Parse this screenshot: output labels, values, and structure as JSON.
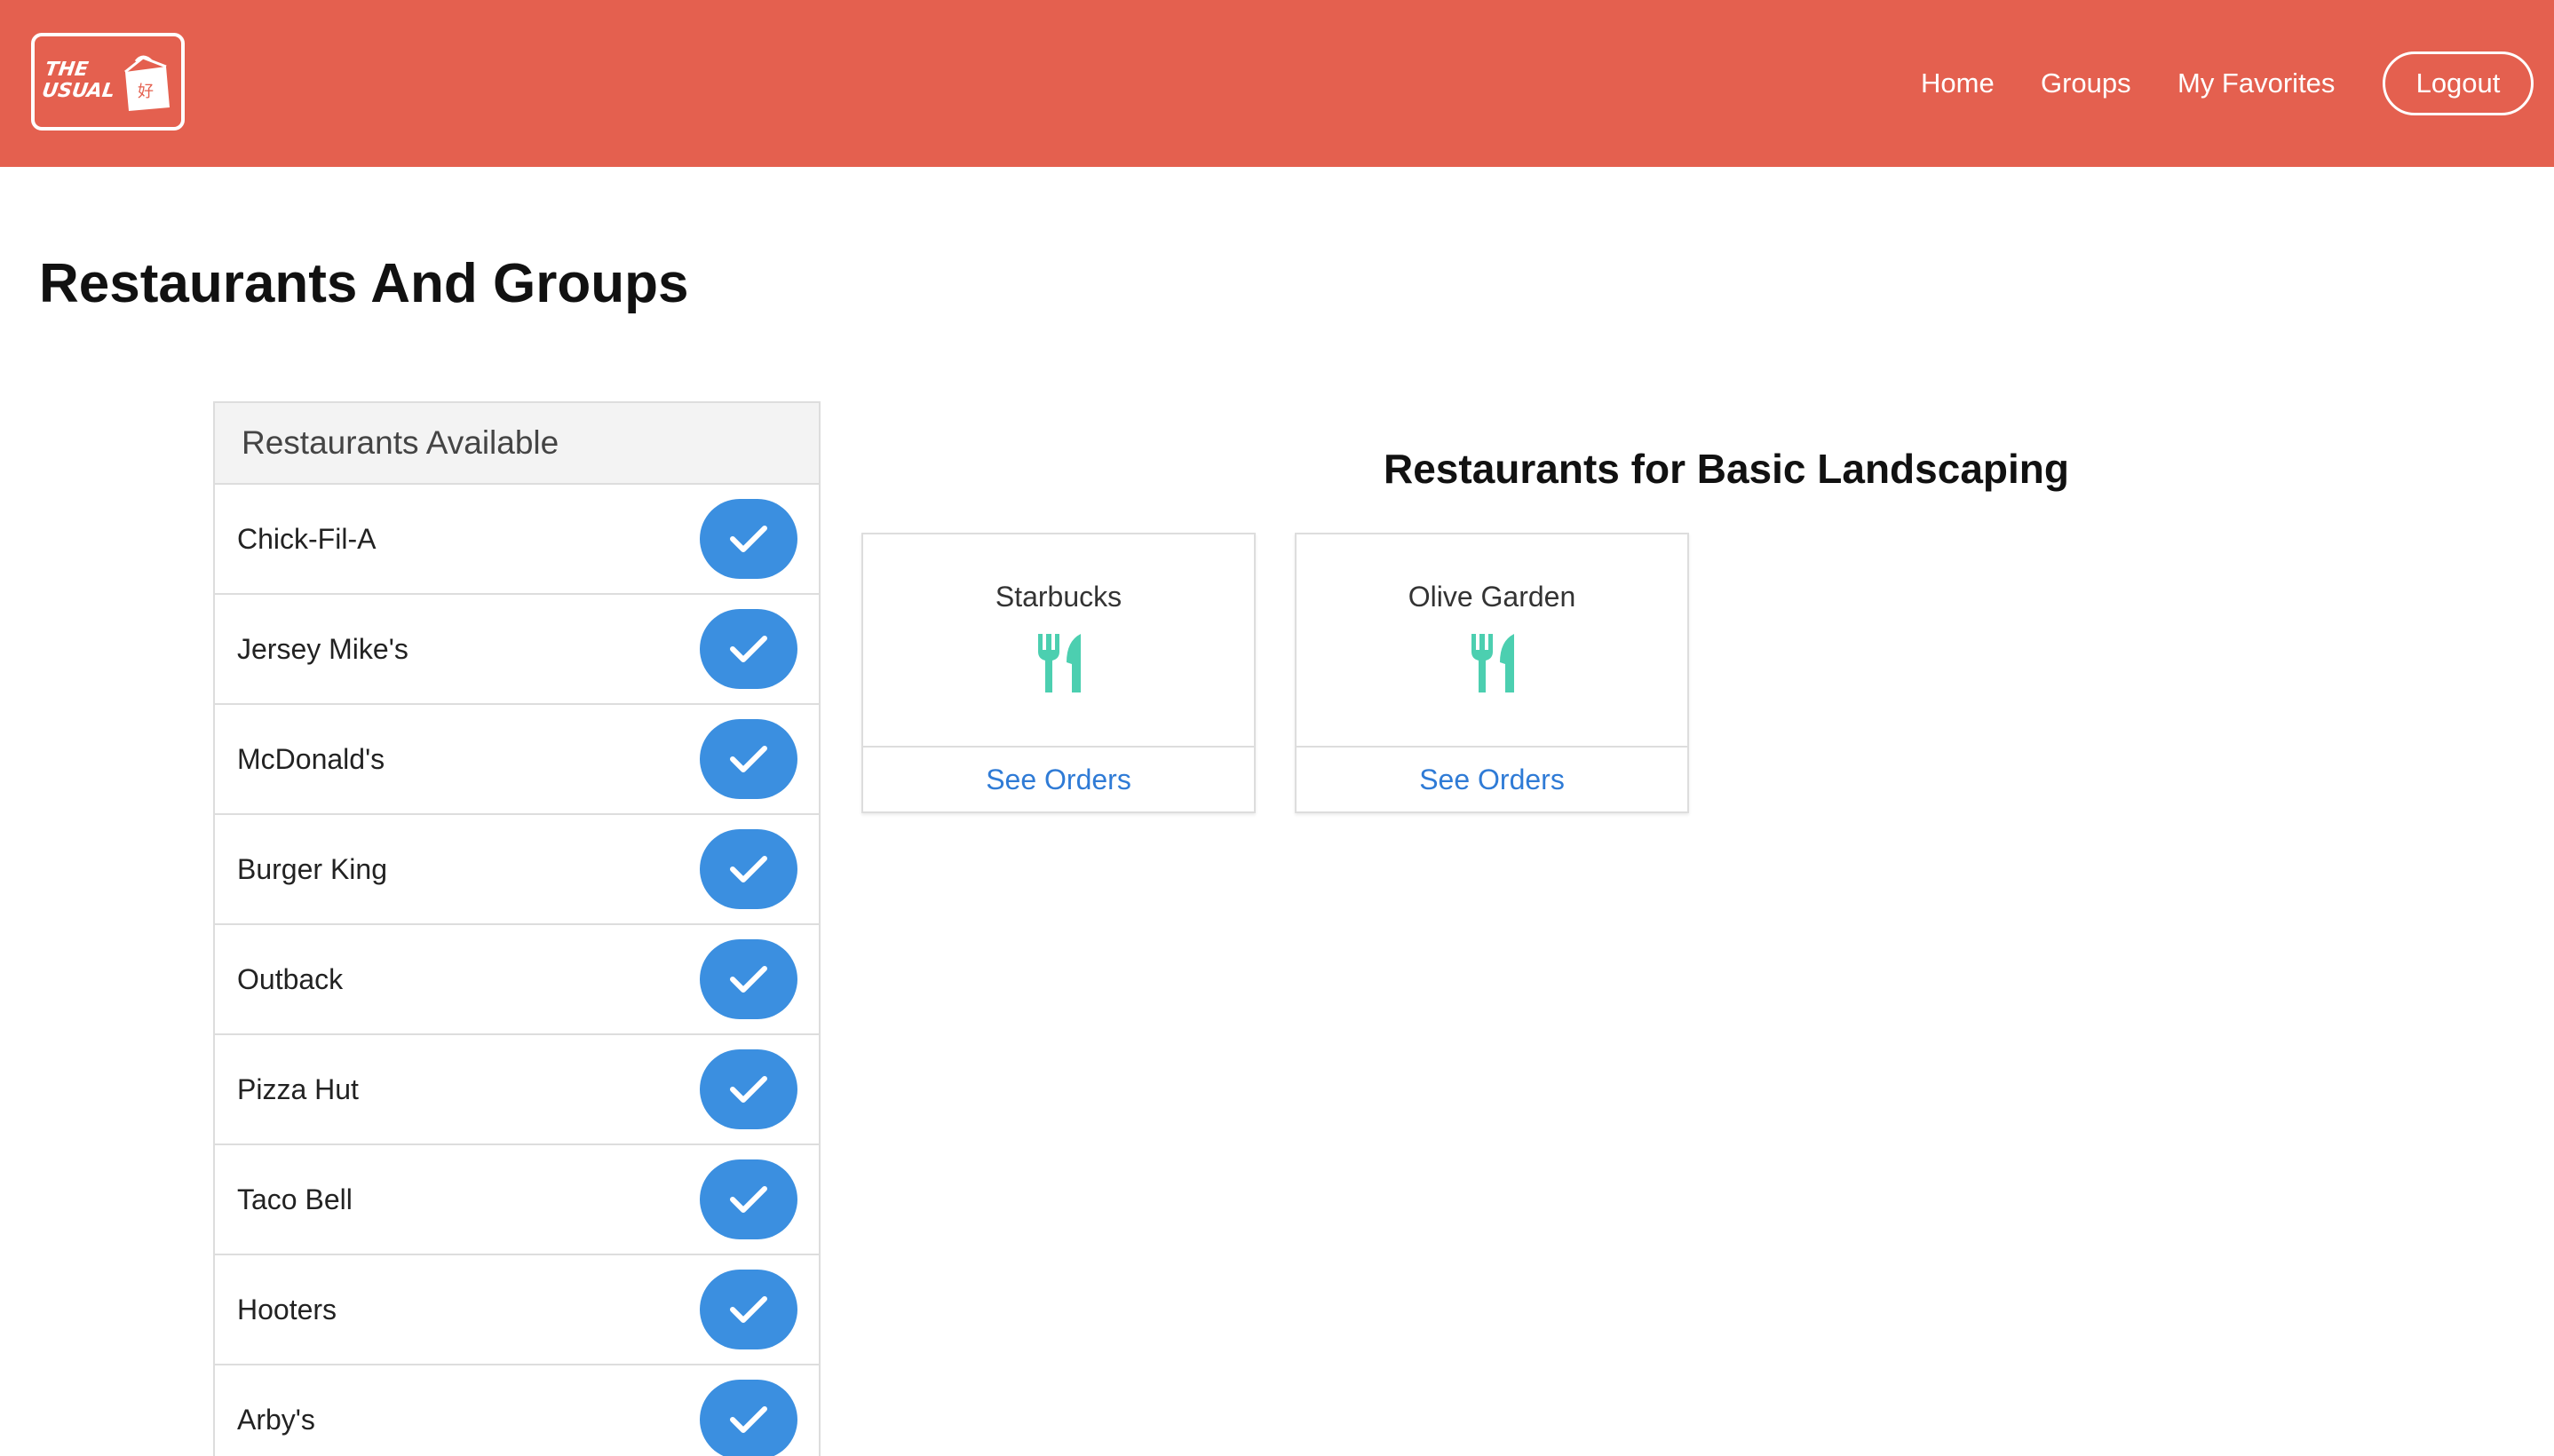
{
  "navbar": {
    "logo_text_line1": "THE",
    "logo_text_line2": "USUAL",
    "links": {
      "home": "Home",
      "groups": "Groups",
      "favorites": "My Favorites"
    },
    "logout_label": "Logout",
    "background_color": "#e4604f"
  },
  "page": {
    "title": "Restaurants And Groups"
  },
  "restaurants_list": {
    "header": "Restaurants Available",
    "items": [
      {
        "label": "Chick-Fil-A",
        "icon": "check-icon"
      },
      {
        "label": "Jersey Mike's",
        "icon": "check-icon"
      },
      {
        "label": "McDonald's",
        "icon": "check-icon"
      },
      {
        "label": "Burger King",
        "icon": "check-icon"
      },
      {
        "label": "Outback",
        "icon": "check-icon"
      },
      {
        "label": "Pizza Hut",
        "icon": "check-icon"
      },
      {
        "label": "Taco Bell",
        "icon": "check-icon"
      },
      {
        "label": "Hooters",
        "icon": "check-icon"
      },
      {
        "label": "Arby's",
        "icon": "check-icon"
      }
    ],
    "check_button_color": "#3b8fe0"
  },
  "group_section": {
    "title": "Restaurants for Basic Landscaping",
    "cards": [
      {
        "name": "Starbucks",
        "icon": "utensils-icon",
        "action": "See Orders"
      },
      {
        "name": "Olive Garden",
        "icon": "utensils-icon",
        "action": "See Orders"
      }
    ],
    "icon_color": "#4ccfb0",
    "link_color": "#2f7bd6"
  }
}
